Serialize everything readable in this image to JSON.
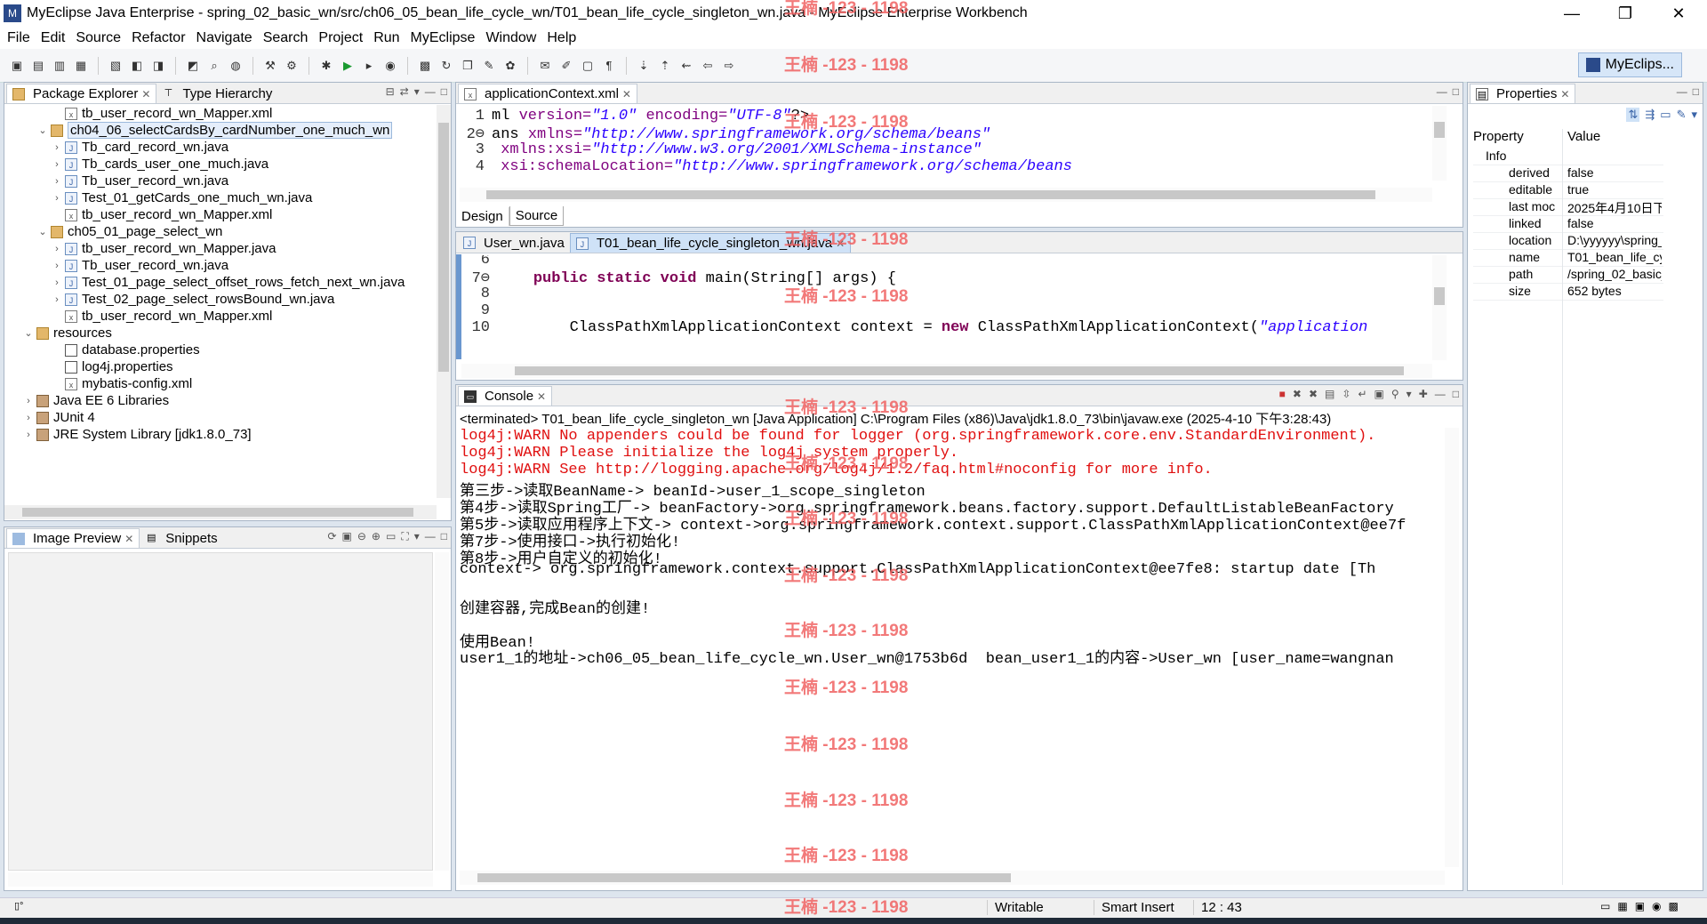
{
  "window": {
    "title": "MyEclipse Java Enterprise - spring_02_basic_wn/src/ch06_05_bean_life_cycle_wn/T01_bean_life_cycle_singleton_wn.java - MyEclipse Enterprise Workbench",
    "minimize": "—",
    "maximize": "❐",
    "close": "✕"
  },
  "menu": [
    "File",
    "Edit",
    "Source",
    "Refactor",
    "Navigate",
    "Search",
    "Project",
    "Run",
    "MyEclipse",
    "Window",
    "Help"
  ],
  "perspective": {
    "label": "MyEclips..."
  },
  "package_explorer": {
    "tabs": [
      "Package Explorer",
      "Type Hierarchy"
    ],
    "rows": [
      {
        "label": "tb_user_record_wn_Mapper.xml",
        "icon": "xml",
        "chev": ""
      },
      {
        "label": "ch04_06_selectCardsBy_cardNumber_one_much_wn",
        "icon": "pkg",
        "chev": "v"
      },
      {
        "label": "Tb_card_record_wn.java",
        "icon": "java",
        "chev": ">"
      },
      {
        "label": "Tb_cards_user_one_much.java",
        "icon": "java",
        "chev": ">"
      },
      {
        "label": "Tb_user_record_wn.java",
        "icon": "java",
        "chev": ">"
      },
      {
        "label": "Test_01_getCards_one_much_wn.java",
        "icon": "java",
        "chev": ">"
      },
      {
        "label": "tb_user_record_wn_Mapper.xml",
        "icon": "xml",
        "chev": ""
      },
      {
        "label": "ch05_01_page_select_wn",
        "icon": "pkg",
        "chev": "v"
      },
      {
        "label": "tb_user_record_wn_Mapper.java",
        "icon": "java",
        "chev": ">"
      },
      {
        "label": "Tb_user_record_wn.java",
        "icon": "java",
        "chev": ">"
      },
      {
        "label": "Test_01_page_select_offset_rows_fetch_next_wn.java",
        "icon": "java",
        "chev": ">"
      },
      {
        "label": "Test_02_page_select_rowsBound_wn.java",
        "icon": "java",
        "chev": ">"
      },
      {
        "label": "tb_user_record_wn_Mapper.xml",
        "icon": "xml",
        "chev": ""
      },
      {
        "label": "resources",
        "icon": "pkg",
        "chev": "v"
      },
      {
        "label": "database.properties",
        "icon": "prop",
        "chev": ""
      },
      {
        "label": "log4j.properties",
        "icon": "prop",
        "chev": ""
      },
      {
        "label": "mybatis-config.xml",
        "icon": "xml",
        "chev": ""
      },
      {
        "label": "Java EE 6 Libraries",
        "icon": "lib",
        "chev": ">"
      },
      {
        "label": "JUnit 4",
        "icon": "lib",
        "chev": ">"
      },
      {
        "label": "JRE System Library [jdk1.8.0_73]",
        "icon": "lib",
        "chev": ">"
      }
    ]
  },
  "image_preview": {
    "tabs": [
      "Image Preview",
      "Snippets"
    ]
  },
  "xml_editor": {
    "tab": "applicationContext.xml",
    "lines": [
      {
        "n": "1",
        "parts": [
          [
            "ml ",
            ""
          ],
          [
            "version=",
            "attr"
          ],
          [
            "\"1.0\"",
            "str"
          ],
          [
            " encoding=",
            "attr"
          ],
          [
            "\"UTF-8\"",
            "str"
          ],
          [
            "?>",
            ""
          ]
        ]
      },
      {
        "n": "2⊖",
        "parts": [
          [
            "ans ",
            ""
          ],
          [
            "xmlns=",
            "attr"
          ],
          [
            "\"http://www.springframework.org/schema/beans\"",
            "str"
          ]
        ]
      },
      {
        "n": "3",
        "parts": [
          [
            " xmlns:xsi=",
            "attr"
          ],
          [
            "\"http://www.w3.org/2001/XMLSchema-instance\"",
            "str"
          ]
        ]
      },
      {
        "n": "4",
        "parts": [
          [
            " xsi:schemaLocation=",
            "attr"
          ],
          [
            "\"http://www.springframework.org/schema/beans",
            "str"
          ]
        ]
      }
    ],
    "bottom_tabs": [
      "Design",
      "Source"
    ]
  },
  "java_editor": {
    "tabs": [
      "User_wn.java",
      "T01_bean_life_cycle_singleton_wn.java"
    ],
    "lines": [
      {
        "n": "6",
        "parts": []
      },
      {
        "n": "7⊖",
        "parts": [
          [
            "    ",
            ""
          ],
          [
            "public static void",
            "kw"
          ],
          [
            " main(String[] args) {",
            ""
          ]
        ]
      },
      {
        "n": "8",
        "parts": []
      },
      {
        "n": "9",
        "parts": []
      },
      {
        "n": "10",
        "parts": [
          [
            "        ClassPathXmlApplicationContext context = ",
            ""
          ],
          [
            "new",
            "kw"
          ],
          [
            " ClassPathXmlApplicationContext(",
            ""
          ],
          [
            "\"application",
            "str"
          ]
        ]
      }
    ]
  },
  "console": {
    "tab": "Console",
    "header": "<terminated> T01_bean_life_cycle_singleton_wn [Java Application] C:\\Program Files (x86)\\Java\\jdk1.8.0_73\\bin\\javaw.exe (2025-4-10 下午3:28:43)",
    "lines": [
      {
        "t": "log4j:WARN No appenders could be found for logger (org.springframework.core.env.StandardEnvironment).",
        "err": true
      },
      {
        "t": "log4j:WARN Please initialize the log4j system properly.",
        "err": true
      },
      {
        "t": "log4j:WARN See http://logging.apache.org/log4j/1.2/faq.html#noconfig for more info.",
        "err": true
      },
      {
        "t": "第三步->读取BeanName-> beanId->user_1_scope_singleton",
        "err": false
      },
      {
        "t": "第4步->读取Spring工厂-> beanFactory->org.springframework.beans.factory.support.DefaultListableBeanFactory",
        "err": false
      },
      {
        "t": "第5步->读取应用程序上下文-> context->org.springframework.context.support.ClassPathXmlApplicationContext@ee7f",
        "err": false
      },
      {
        "t": "第7步->使用接口->执行初始化!",
        "err": false
      },
      {
        "t": "第8步->用户自定义的初始化!",
        "err": false
      },
      {
        "t": "context-> org.springframework.context.support.ClassPathXmlApplicationContext@ee7fe8: startup date [Th",
        "err": false
      },
      {
        "t": "",
        "err": false
      },
      {
        "t": "创建容器,完成Bean的创建!",
        "err": false
      },
      {
        "t": "",
        "err": false
      },
      {
        "t": "使用Bean!",
        "err": false
      },
      {
        "t": "user1_1的地址->ch06_05_bean_life_cycle_wn.User_wn@1753b6d  bean_user1_1的内容->User_wn [user_name=wangnan",
        "err": false
      }
    ]
  },
  "properties": {
    "tab": "Properties",
    "col_property": "Property",
    "col_value": "Value",
    "rows": [
      {
        "k": "Info",
        "v": "",
        "group": true
      },
      {
        "k": "derived",
        "v": "false"
      },
      {
        "k": "editable",
        "v": "true"
      },
      {
        "k": "last moc",
        "v": "2025年4月10日下..."
      },
      {
        "k": "linked",
        "v": "false"
      },
      {
        "k": "location",
        "v": "D:\\yyyyyy\\spring_..."
      },
      {
        "k": "name",
        "v": "T01_bean_life_cyc..."
      },
      {
        "k": "path",
        "v": "/spring_02_basic_..."
      },
      {
        "k": "size",
        "v": "652  bytes"
      }
    ]
  },
  "status": {
    "writable": "Writable",
    "insert": "Smart Insert",
    "position": "12 : 43"
  },
  "watermark": "王楠 -123 - 1198",
  "colors": {
    "error": "#e01010",
    "keyword": "#7f0055",
    "string": "#2a00ff",
    "selection": "#cfe2f7"
  }
}
